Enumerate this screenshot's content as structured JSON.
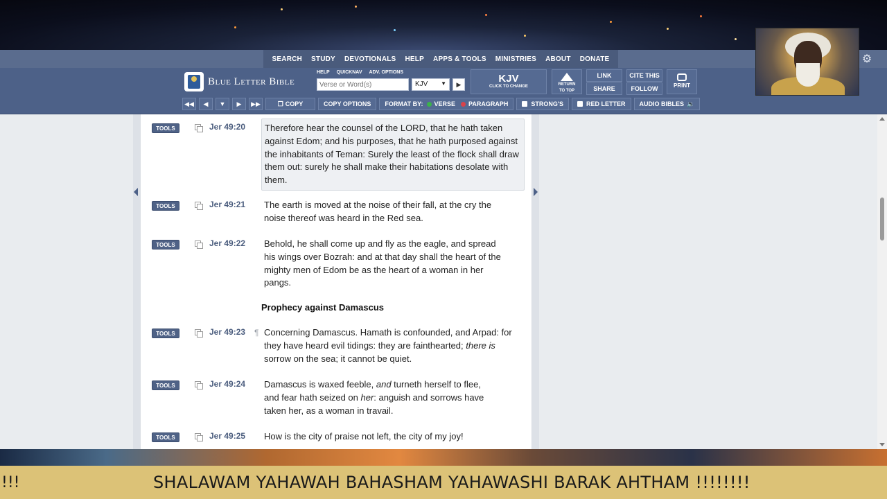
{
  "topnav": {
    "items": [
      "SEARCH",
      "STUDY",
      "DEVOTIONALS",
      "HELP",
      "APPS & TOOLS",
      "MINISTRIES",
      "ABOUT",
      "DONATE"
    ]
  },
  "logo": {
    "text": "Blue Letter Bible"
  },
  "search": {
    "mini_links": [
      "HELP",
      "QUICKNAV",
      "ADV. OPTIONS"
    ],
    "placeholder": "Verse or Word(s)",
    "version": "KJV"
  },
  "version_box": {
    "title": "KJV",
    "subtitle": "CLICK TO CHANGE"
  },
  "return_top": {
    "line1": "RETURN",
    "line2": "TO TOP"
  },
  "actions": {
    "link": "LINK",
    "share": "SHARE",
    "cite": "CITE THIS",
    "follow": "FOLLOW",
    "print": "PRINT"
  },
  "options": {
    "copy": "COPY",
    "copy_options": "COPY OPTIONS",
    "format_by": "FORMAT BY:",
    "verse": "VERSE",
    "paragraph": "PARAGRAPH",
    "strongs": "STRONG'S",
    "red_letter": "RED LETTER",
    "audio_bibles": "AUDIO BIBLES"
  },
  "colors": {
    "nav_bg": "#5a6c8e",
    "toolbar_bg": "#4d6188",
    "tools_btn": "#4f6286",
    "verse_green": "#3bb34a",
    "paragraph_red": "#d9434b"
  },
  "verses": [
    {
      "tools": "TOOLS",
      "ref": "Jer 49:20",
      "para": "",
      "text": "Therefore hear the counsel of the LORD, that he hath taken against Edom; and his purposes, that he hath purposed against the inhabitants of Teman: Surely the least of the flock shall draw them out: surely he shall make their habitations desolate with them."
    },
    {
      "tools": "TOOLS",
      "ref": "Jer 49:21",
      "para": "",
      "text": "The earth is moved at the noise of their fall, at the cry the noise thereof was heard in the Red sea."
    },
    {
      "tools": "TOOLS",
      "ref": "Jer 49:22",
      "para": "",
      "text": "Behold, he shall come up and fly as the eagle, and spread his wings over Bozrah: and at that day shall the heart of the mighty men of Edom be as the heart of a woman in her pangs."
    },
    {
      "tools": "TOOLS",
      "ref": "Jer 49:23",
      "para": "¶",
      "text_a": "Concerning Damascus. Hamath is confounded, and Arpad: for they have heard evil tidings: they are fainthearted; ",
      "text_i": "there is",
      "text_b": " sorrow on the sea; it cannot be quiet."
    },
    {
      "tools": "TOOLS",
      "ref": "Jer 49:24",
      "para": "",
      "text_a": "Damascus is waxed feeble, ",
      "text_i": "and",
      "text_b": " turneth herself to flee, and fear hath seized on ",
      "text_i2": "her",
      "text_c": ": anguish and sorrows have taken her, as a woman in travail."
    },
    {
      "tools": "TOOLS",
      "ref": "Jer 49:25",
      "para": "",
      "text": "How is the city of praise not left, the city of my joy!"
    }
  ],
  "heading": "Prophecy against Damascus",
  "banner": {
    "left": "!!!",
    "text": "SHALAWAM YAHAWAH BAHASHAM YAHAWASHI BARAK AHTHAM !!!!!!!!"
  }
}
